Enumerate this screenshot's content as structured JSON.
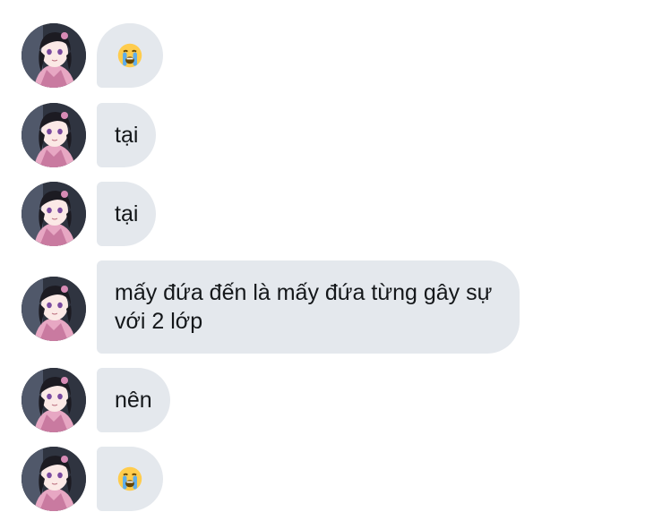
{
  "messages": [
    {
      "type": "emoji",
      "emoji": "loudly-crying-face-icon"
    },
    {
      "type": "text",
      "text": "tại"
    },
    {
      "type": "text",
      "text": "tại"
    },
    {
      "type": "text",
      "text": "mấy đứa đến là mấy đứa từng gây sự với 2 lớp"
    },
    {
      "type": "text",
      "text": "nên"
    },
    {
      "type": "emoji",
      "emoji": "loudly-crying-face-icon"
    }
  ],
  "colors": {
    "bubble": "#e4e8ed",
    "text": "#14171a",
    "background": "#ffffff"
  }
}
